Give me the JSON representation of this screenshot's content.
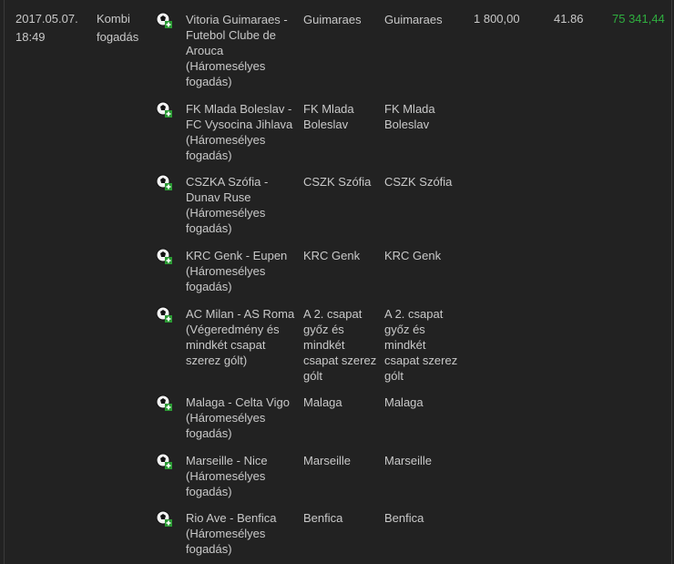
{
  "bet": {
    "date": "2017.05.07.",
    "time": "18:49",
    "type": "Kombi fogadás",
    "stake": "1 800,00",
    "odds": "41.86",
    "winnings": "75 341,44"
  },
  "legs": [
    {
      "event": "Vitoria Guimaraes - Futebol Clube de Arouca",
      "market": "(Háromesélyes fogadás)",
      "pick": "Guimaraes",
      "result": "Guimaraes",
      "icon": "football-ball-icon"
    },
    {
      "event": "FK Mlada Boleslav - FC Vysocina Jihlava",
      "market": "(Háromesélyes fogadás)",
      "pick": "FK Mlada Boleslav",
      "result": "FK Mlada Boleslav",
      "icon": "football-ball-icon"
    },
    {
      "event": "CSZKA Szófia - Dunav Ruse",
      "market": "(Háromesélyes fogadás)",
      "pick": "CSZK Szófia",
      "result": "CSZK Szófia",
      "icon": "football-ball-icon"
    },
    {
      "event": "KRC Genk - Eupen",
      "market": "(Háromesélyes fogadás)",
      "pick": "KRC Genk",
      "result": "KRC Genk",
      "icon": "football-ball-icon"
    },
    {
      "event": "AC Milan - AS Roma",
      "market": "(Végeredmény és mindkét csapat szerez gólt)",
      "pick": "A 2. csapat győz és mindkét csapat szerez gólt",
      "result": "A 2. csapat győz és mindkét csapat szerez gólt",
      "icon": "football-ball-icon"
    },
    {
      "event": "Malaga - Celta Vigo",
      "market": "(Háromesélyes fogadás)",
      "pick": "Malaga",
      "result": "Malaga",
      "icon": "football-ball-icon"
    },
    {
      "event": "Marseille - Nice",
      "market": "(Háromesélyes fogadás)",
      "pick": "Marseille",
      "result": "Marseille",
      "icon": "football-ball-icon"
    },
    {
      "event": "Rio Ave - Benfica",
      "market": "(Háromesélyes fogadás)",
      "pick": "Benfica",
      "result": "Benfica",
      "icon": "football-ball-icon"
    }
  ],
  "colors": {
    "background": "#222222",
    "text": "#c9c9c9",
    "win": "#2fae3f"
  }
}
